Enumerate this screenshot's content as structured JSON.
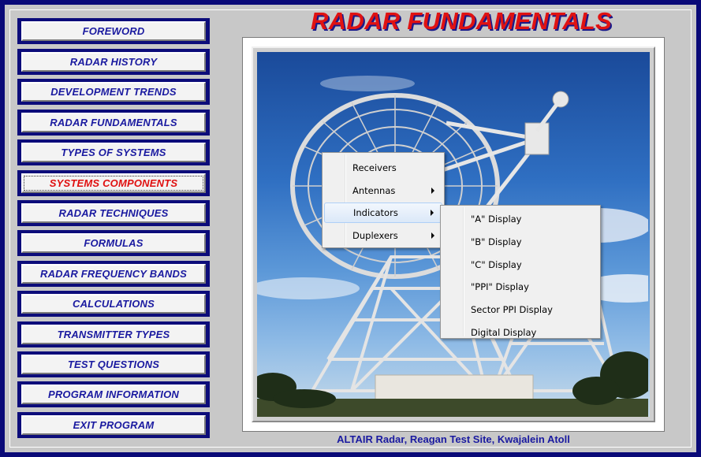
{
  "title": "RADAR FUNDAMENTALS",
  "caption": "ALTAIR Radar, Reagan Test Site, Kwajalein Atoll",
  "nav": [
    {
      "label": "FOREWORD"
    },
    {
      "label": "RADAR HISTORY"
    },
    {
      "label": "DEVELOPMENT TRENDS"
    },
    {
      "label": "RADAR FUNDAMENTALS"
    },
    {
      "label": "TYPES OF SYSTEMS"
    },
    {
      "label": "SYSTEMS COMPONENTS"
    },
    {
      "label": "RADAR TECHNIQUES"
    },
    {
      "label": "FORMULAS"
    },
    {
      "label": "RADAR FREQUENCY BANDS"
    },
    {
      "label": "CALCULATIONS"
    },
    {
      "label": "TRANSMITTER TYPES"
    },
    {
      "label": "TEST QUESTIONS"
    },
    {
      "label": "PROGRAM INFORMATION"
    },
    {
      "label": "EXIT PROGRAM"
    }
  ],
  "active_nav": "SYSTEMS COMPONENTS",
  "context_menu": {
    "items": [
      {
        "label": "Receivers",
        "submenu": false
      },
      {
        "label": "Antennas",
        "submenu": true
      },
      {
        "label": "Indicators",
        "submenu": true,
        "highlighted": true
      },
      {
        "label": "Duplexers",
        "submenu": true
      }
    ]
  },
  "submenu": {
    "items": [
      {
        "label": "\"A\" Display"
      },
      {
        "label": "\"B\" Display"
      },
      {
        "label": "\"C\" Display"
      },
      {
        "label": "\"PPI\" Display"
      },
      {
        "label": "Sector PPI Display"
      },
      {
        "label": "Digital Display"
      }
    ]
  },
  "colors": {
    "frame": "#0a0a78",
    "nav_text": "#1a1aa0",
    "active_text": "#e01010",
    "title": "#e01212"
  }
}
